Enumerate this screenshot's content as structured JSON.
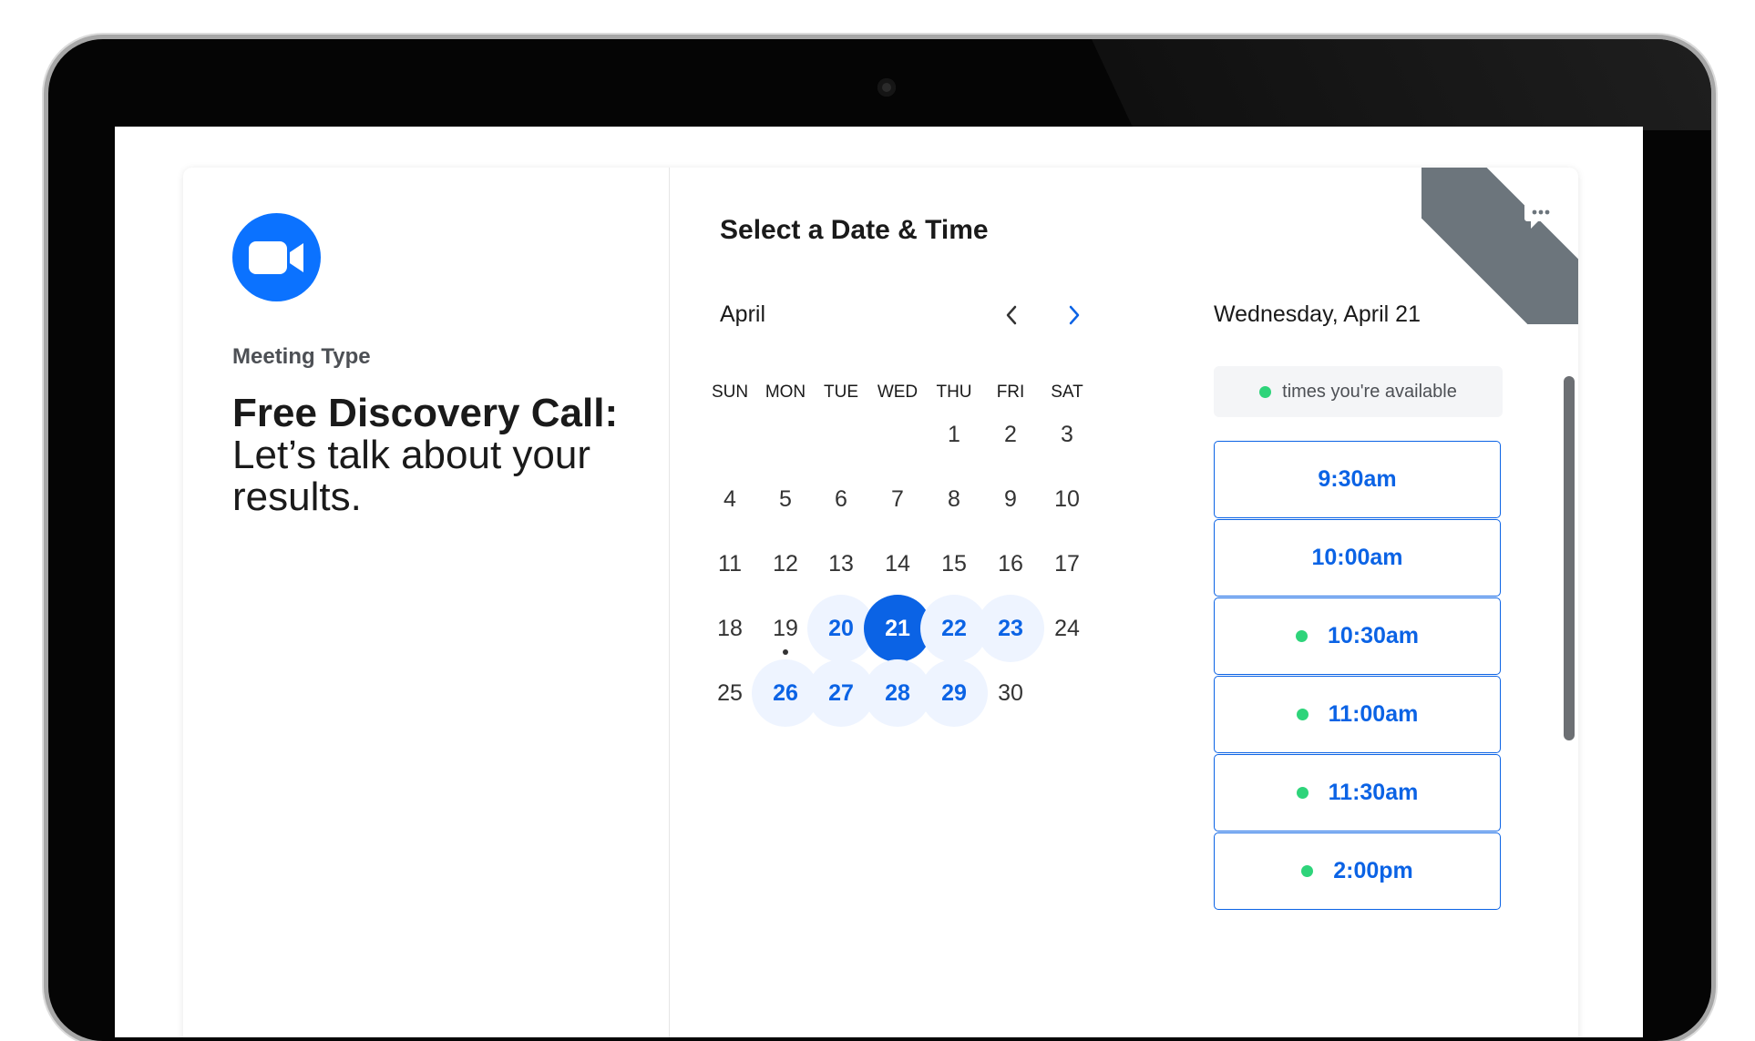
{
  "left": {
    "meeting_type_label": "Meeting Type",
    "title_bold": "Free Discovery Call:",
    "title_rest": " Let’s talk about your results."
  },
  "right": {
    "section_title": "Select a Date & Time",
    "month": "April",
    "selected_date_heading": "Wednesday, April 21",
    "legend_text": "times you're available",
    "weekdays": [
      "SUN",
      "MON",
      "TUE",
      "WED",
      "THU",
      "FRI",
      "SAT"
    ],
    "days": [
      {
        "label": "1",
        "state": "normal"
      },
      {
        "label": "2",
        "state": "normal"
      },
      {
        "label": "3",
        "state": "normal"
      },
      {
        "label": "4",
        "state": "normal"
      },
      {
        "label": "5",
        "state": "normal"
      },
      {
        "label": "6",
        "state": "normal"
      },
      {
        "label": "7",
        "state": "normal"
      },
      {
        "label": "8",
        "state": "normal"
      },
      {
        "label": "9",
        "state": "normal"
      },
      {
        "label": "10",
        "state": "normal"
      },
      {
        "label": "11",
        "state": "normal"
      },
      {
        "label": "12",
        "state": "normal"
      },
      {
        "label": "13",
        "state": "normal"
      },
      {
        "label": "14",
        "state": "normal"
      },
      {
        "label": "15",
        "state": "normal"
      },
      {
        "label": "16",
        "state": "normal"
      },
      {
        "label": "17",
        "state": "normal"
      },
      {
        "label": "18",
        "state": "normal"
      },
      {
        "label": "19",
        "state": "today"
      },
      {
        "label": "20",
        "state": "available"
      },
      {
        "label": "21",
        "state": "selected"
      },
      {
        "label": "22",
        "state": "available"
      },
      {
        "label": "23",
        "state": "available"
      },
      {
        "label": "24",
        "state": "normal"
      },
      {
        "label": "25",
        "state": "normal"
      },
      {
        "label": "26",
        "state": "available"
      },
      {
        "label": "27",
        "state": "available"
      },
      {
        "label": "28",
        "state": "available"
      },
      {
        "label": "29",
        "state": "available"
      },
      {
        "label": "30",
        "state": "normal"
      }
    ],
    "first_weekday_index": 4,
    "time_slots": [
      {
        "label": "9:30am",
        "available_dot": false
      },
      {
        "label": "10:00am",
        "available_dot": false
      },
      {
        "label": "10:30am",
        "available_dot": true
      },
      {
        "label": "11:00am",
        "available_dot": true
      },
      {
        "label": "11:30am",
        "available_dot": true
      },
      {
        "label": "2:00pm",
        "available_dot": true
      }
    ]
  },
  "colors": {
    "accent": "#0b63e5",
    "available_bg": "#eef4ff",
    "green": "#2ed47a",
    "zoom_blue": "#0b72ff"
  },
  "icons": {
    "logo": "video-camera-icon",
    "prev": "chevron-left-icon",
    "next": "chevron-right-icon",
    "ribbon": "chat-bubble-icon"
  }
}
